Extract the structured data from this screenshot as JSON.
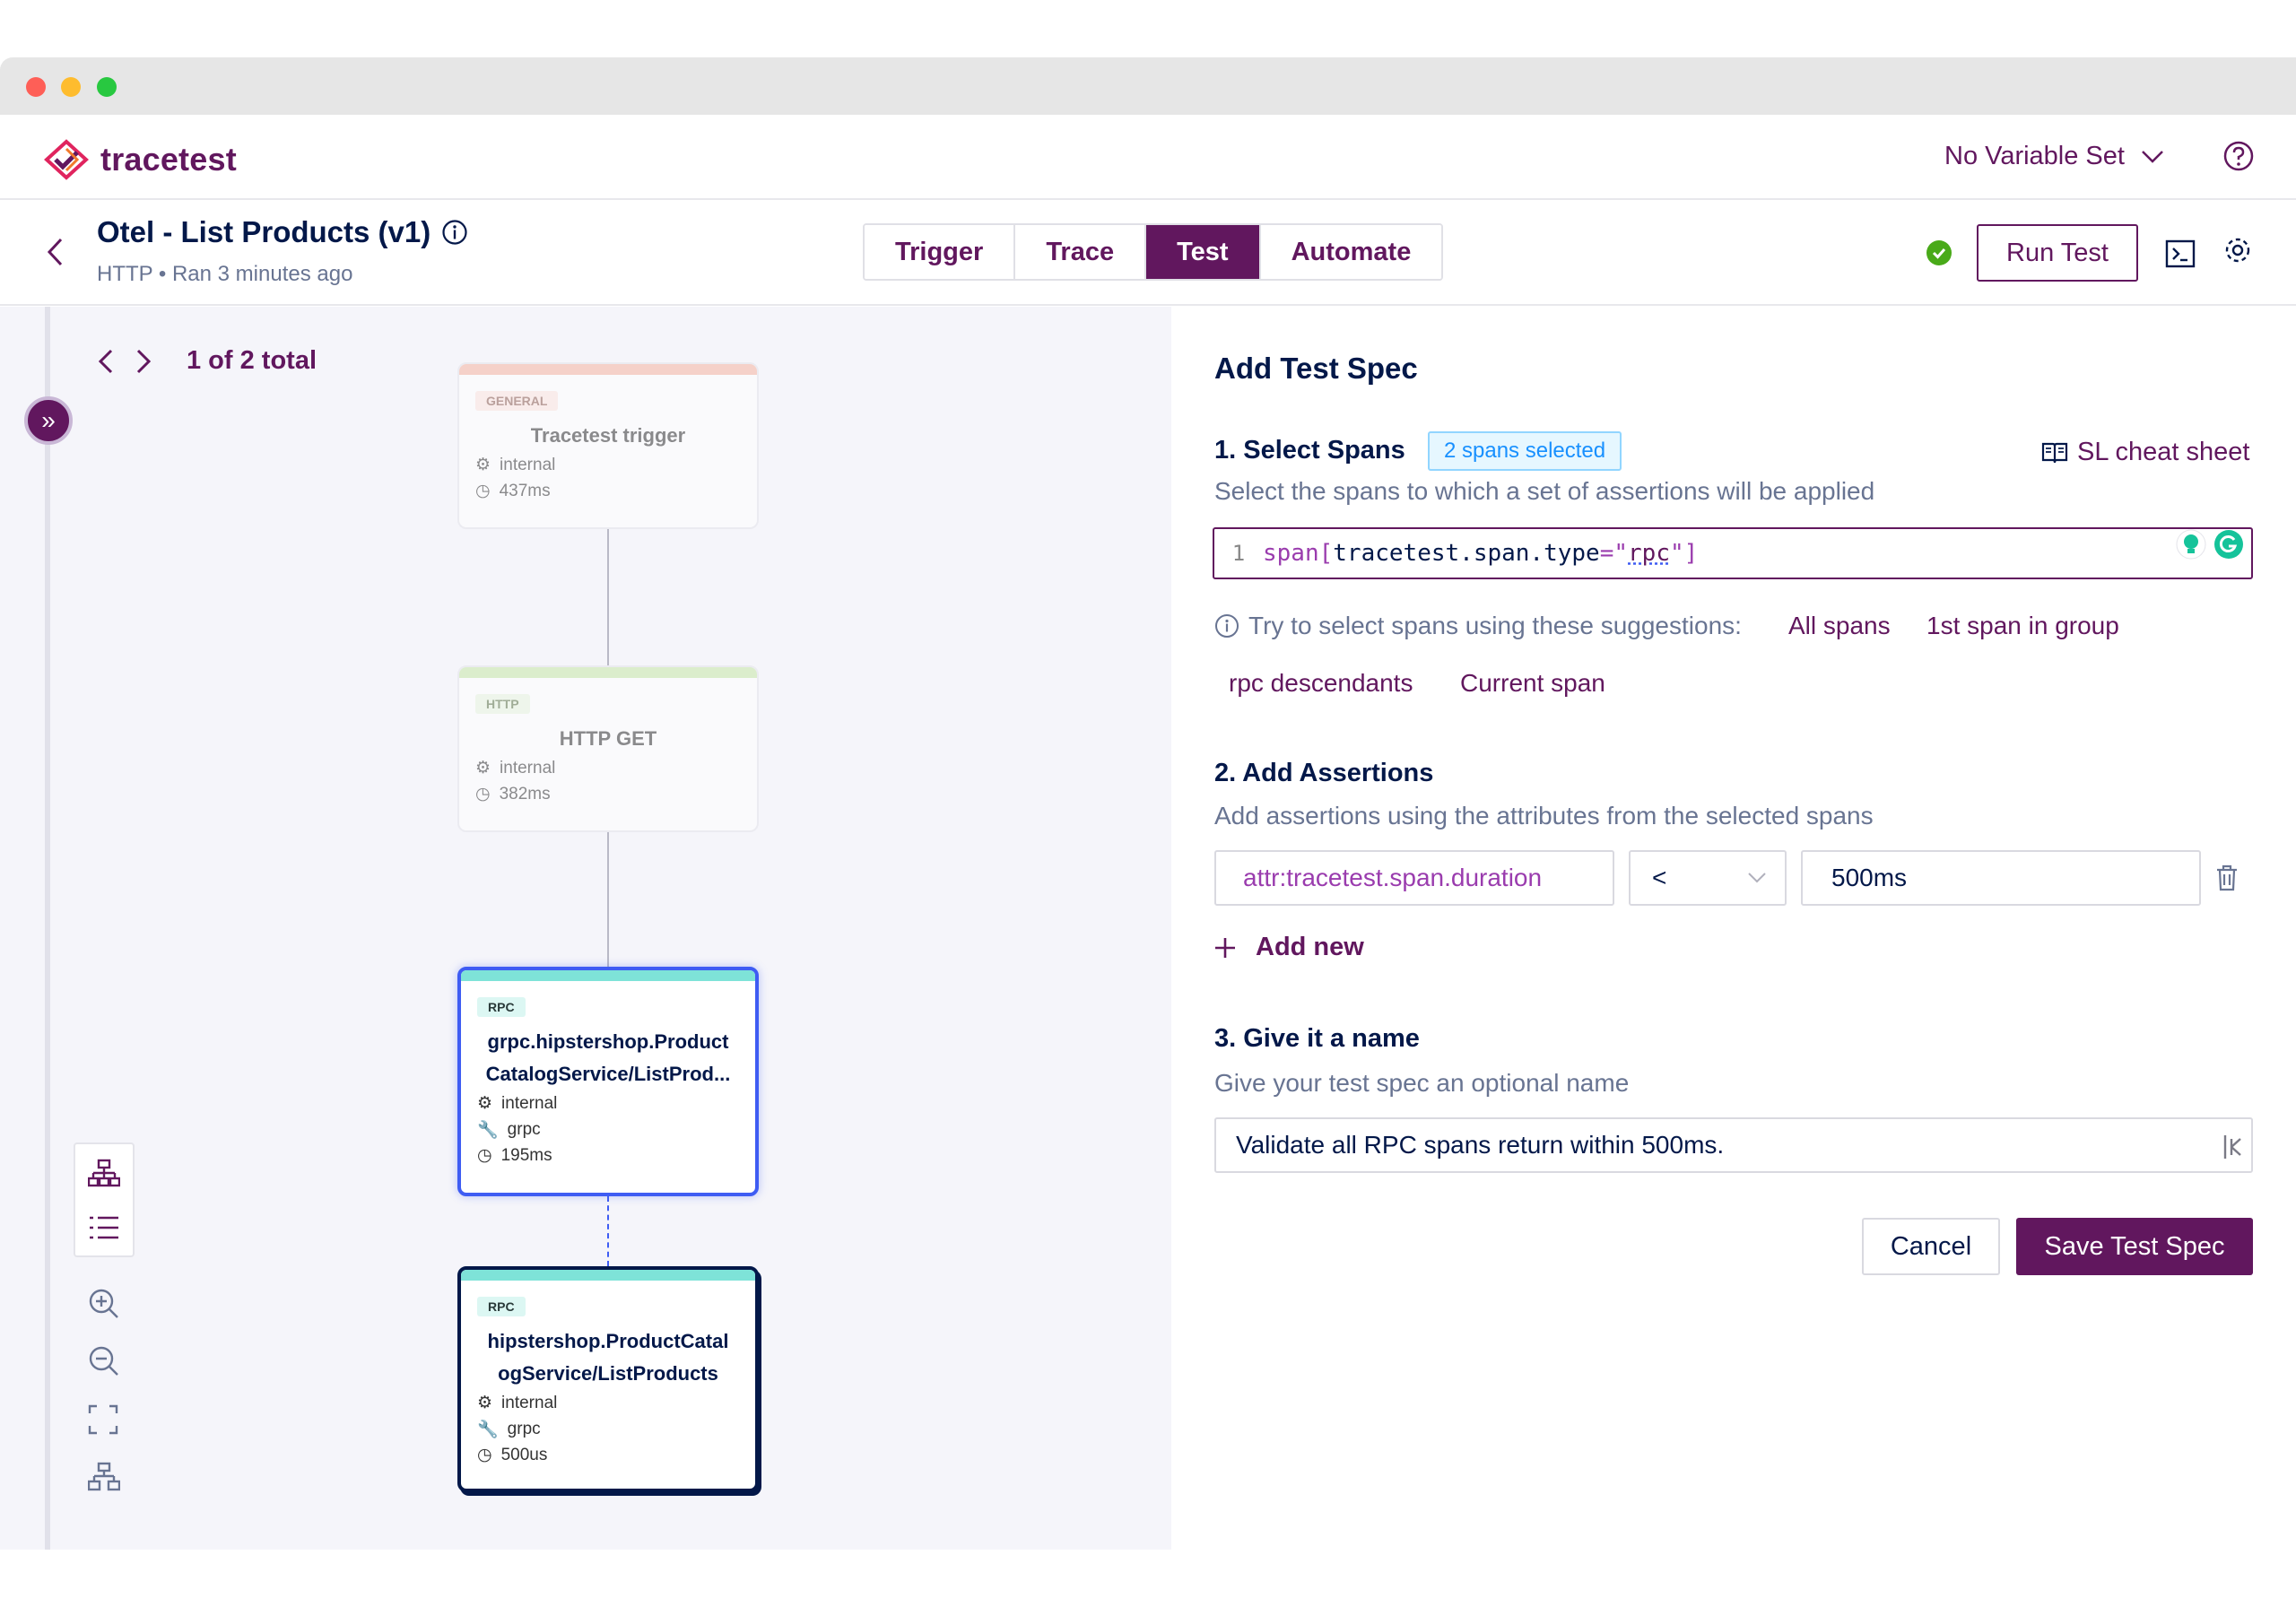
{
  "app": {
    "logo_text": "tracetest",
    "variable_set": "No Variable Set"
  },
  "test": {
    "title": "Otel - List Products (v1)",
    "subtitle": "HTTP • Ran 3 minutes ago",
    "tabs": [
      "Trigger",
      "Trace",
      "Test",
      "Automate"
    ],
    "active_tab": "Test",
    "run_label": "Run Test"
  },
  "pager": {
    "label": "1 of 2 total"
  },
  "nodes": [
    {
      "tag": "GENERAL",
      "name": "Tracetest trigger",
      "meta": [
        {
          "icon": "gear-icon",
          "text": "internal"
        },
        {
          "icon": "clock-icon",
          "text": "437ms"
        }
      ]
    },
    {
      "tag": "HTTP",
      "name": "HTTP GET",
      "meta": [
        {
          "icon": "gear-icon",
          "text": "internal"
        },
        {
          "icon": "clock-icon",
          "text": "382ms"
        }
      ]
    },
    {
      "tag": "RPC",
      "name_line1": "grpc.hipstershop.Product",
      "name_line2": "CatalogService/ListProd...",
      "meta": [
        {
          "icon": "gear-icon",
          "text": "internal"
        },
        {
          "icon": "wrench-icon",
          "text": "grpc"
        },
        {
          "icon": "clock-icon",
          "text": "195ms"
        }
      ]
    },
    {
      "tag": "RPC",
      "name_line1": "hipstershop.ProductCatal",
      "name_line2": "ogService/ListProducts",
      "meta": [
        {
          "icon": "gear-icon",
          "text": "internal"
        },
        {
          "icon": "wrench-icon",
          "text": "grpc"
        },
        {
          "icon": "clock-icon",
          "text": "500us"
        }
      ]
    }
  ],
  "spec": {
    "heading": "Add Test Spec",
    "select_title": "1. Select Spans",
    "spans_badge": "2 spans selected",
    "cheat_sheet": "SL cheat sheet",
    "select_desc": "Select the spans to which a set of assertions will be applied",
    "editor": {
      "line_number": "1",
      "kw": "span[",
      "attr": "tracetest.span.type",
      "eq": "=",
      "q1": "\"",
      "value": "rpc",
      "q2": "\"",
      "close": "]"
    },
    "suggest_intro": "Try to select spans using these suggestions:",
    "suggestions": [
      "All spans",
      "1st span in group",
      "rpc descendants",
      "Current span"
    ],
    "assert_title": "2. Add Assertions",
    "assert_desc": "Add assertions using the attributes from the selected spans",
    "assertion": {
      "attribute": "attr:tracetest.span.duration",
      "operator": "<",
      "value": "500ms"
    },
    "add_new": "Add new",
    "name_title": "3. Give it a name",
    "name_desc": "Give your test spec an optional name",
    "name_value": "Validate all RPC spans return within 500ms.",
    "cancel": "Cancel",
    "save": "Save Test Spec"
  },
  "colors": {
    "brand": "#61175e",
    "selected": "#3e5cf3",
    "success": "#49aa19"
  }
}
